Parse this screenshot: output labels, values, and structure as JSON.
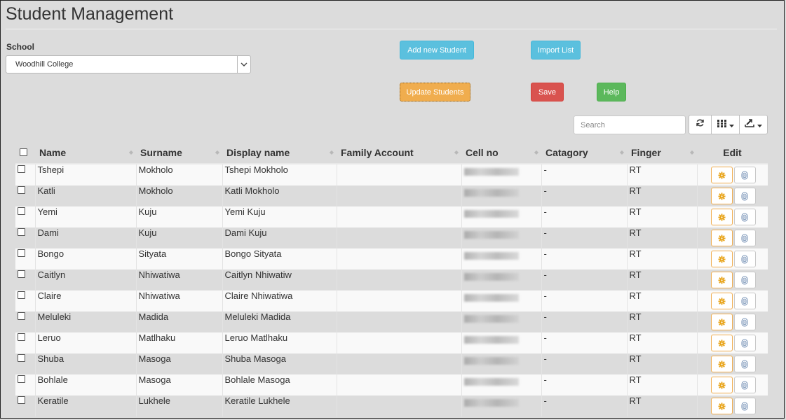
{
  "page": {
    "title": "Student Management"
  },
  "school": {
    "label": "School",
    "selected": "Woodhill College"
  },
  "actions": {
    "add_new_student": "Add new Student",
    "import_list": "Import List",
    "update_students": "Update Students",
    "save": "Save",
    "help": "Help"
  },
  "toolbar": {
    "search_placeholder": "Search",
    "refresh_icon": "refresh-icon",
    "columns_icon": "grid-icon",
    "export_icon": "export-icon"
  },
  "colors": {
    "info": "#5bc0de",
    "warning": "#f0ad4e",
    "danger": "#d9534f",
    "success": "#5cb85c"
  },
  "table": {
    "columns": [
      "Name",
      "Surname",
      "Display name",
      "Family Account",
      "Cell no",
      "Catagory",
      "Finger",
      "Edit"
    ],
    "rows": [
      {
        "name": "Tshepi",
        "surname": "Mokholo",
        "display": "Tshepi Mokholo",
        "family": "",
        "category": "-",
        "finger": "RT"
      },
      {
        "name": "Katli",
        "surname": "Mokholo",
        "display": "Katli Mokholo",
        "family": "",
        "category": "-",
        "finger": "RT"
      },
      {
        "name": "Yemi",
        "surname": "Kuju",
        "display": "Yemi Kuju",
        "family": "",
        "category": "-",
        "finger": "RT"
      },
      {
        "name": "Dami",
        "surname": "Kuju",
        "display": "Dami Kuju",
        "family": "",
        "category": "-",
        "finger": "RT"
      },
      {
        "name": "Bongo",
        "surname": "Sityata",
        "display": "Bongo Sityata",
        "family": "",
        "category": "-",
        "finger": "RT"
      },
      {
        "name": "Caitlyn",
        "surname": "Nhiwatiwa",
        "display": "Caitlyn Nhiwatiw",
        "family": "",
        "category": "-",
        "finger": "RT"
      },
      {
        "name": "Claire",
        "surname": "Nhiwatiwa",
        "display": "Claire Nhiwatiwa",
        "family": "",
        "category": "-",
        "finger": "RT"
      },
      {
        "name": "Meluleki",
        "surname": "Madida",
        "display": "Meluleki Madida",
        "family": "",
        "category": "-",
        "finger": "RT"
      },
      {
        "name": "Leruo",
        "surname": "Matlhaku",
        "display": "Leruo Matlhaku",
        "family": "",
        "category": "-",
        "finger": "RT"
      },
      {
        "name": "Shuba",
        "surname": "Masoga",
        "display": "Shuba Masoga",
        "family": "",
        "category": "-",
        "finger": "RT"
      },
      {
        "name": "Bohlale",
        "surname": "Masoga",
        "display": "Bohlale Masoga",
        "family": "",
        "category": "-",
        "finger": "RT"
      },
      {
        "name": "Keratile",
        "surname": "Lukhele",
        "display": "Keratile Lukhele",
        "family": "",
        "category": "-",
        "finger": "RT"
      }
    ]
  }
}
